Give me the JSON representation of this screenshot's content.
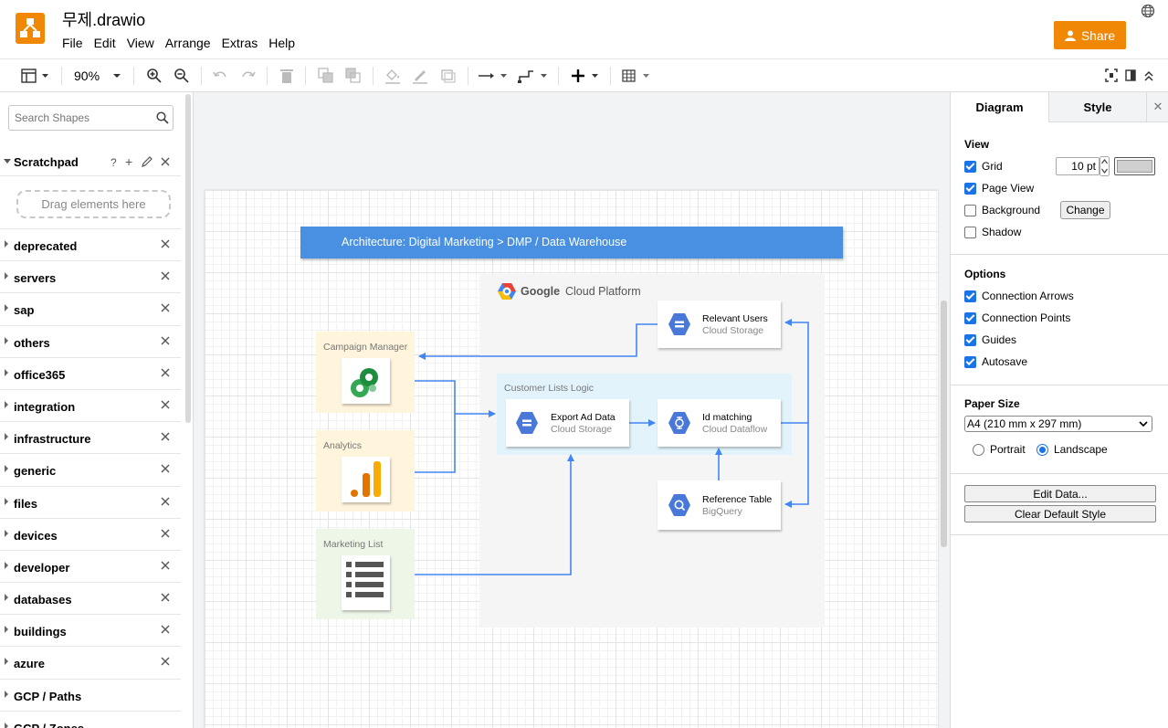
{
  "app": {
    "title": "무제.drawio",
    "share_label": "Share"
  },
  "menu": [
    "File",
    "Edit",
    "View",
    "Arrange",
    "Extras",
    "Help"
  ],
  "toolbar": {
    "zoom": "90%"
  },
  "sidebar": {
    "search_placeholder": "Search Shapes",
    "scratchpad_title": "Scratchpad",
    "scratchpad_help": "?",
    "scratchpad_add": "+",
    "scratchpad_drop": "Drag elements here",
    "libraries": [
      "deprecated",
      "servers",
      "sap",
      "others",
      "office365",
      "integration",
      "infrastructure",
      "generic",
      "files",
      "devices",
      "developer",
      "databases",
      "buildings",
      "azure",
      "GCP / Paths",
      "GCP / Zones"
    ]
  },
  "diagram": {
    "banner": "Architecture: Digital Marketing > DMP / Data Warehouse",
    "gcp_brand": "Google",
    "gcp_suffix": "Cloud Platform",
    "customer_logic": "Customer Lists Logic",
    "sources": [
      "Campaign Manager",
      "Analytics",
      "Marketing List"
    ],
    "nodes": {
      "relevant_users": {
        "title": "Relevant Users",
        "subtitle": "Cloud Storage"
      },
      "export_ad": {
        "title": "Export Ad Data",
        "subtitle": "Cloud Storage"
      },
      "id_matching": {
        "title": "Id matching",
        "subtitle": "Cloud Dataflow"
      },
      "reference": {
        "title": "Reference Table",
        "subtitle": "BigQuery"
      }
    },
    "colors": {
      "banner": "#4a90e2",
      "arrow": "#4285f4",
      "gcp_blue": "#4a78d9",
      "source_yellow": "#fff4dc",
      "source_green": "#eef6e8",
      "logic_blue": "#e2f3fb",
      "gcp_bg": "#f5f5f5"
    }
  },
  "format_panel": {
    "tabs": [
      "Diagram",
      "Style"
    ],
    "close": "✕",
    "view_title": "View",
    "grid_label": "Grid",
    "grid_size": "10 pt",
    "page_view_label": "Page View",
    "background_label": "Background",
    "change_label": "Change",
    "shadow_label": "Shadow",
    "options_title": "Options",
    "options": [
      "Connection Arrows",
      "Connection Points",
      "Guides",
      "Autosave"
    ],
    "paper_title": "Paper Size",
    "paper_value": "A4 (210 mm x 297 mm)",
    "portrait_label": "Portrait",
    "landscape_label": "Landscape",
    "edit_data_label": "Edit Data...",
    "clear_style_label": "Clear Default Style"
  }
}
